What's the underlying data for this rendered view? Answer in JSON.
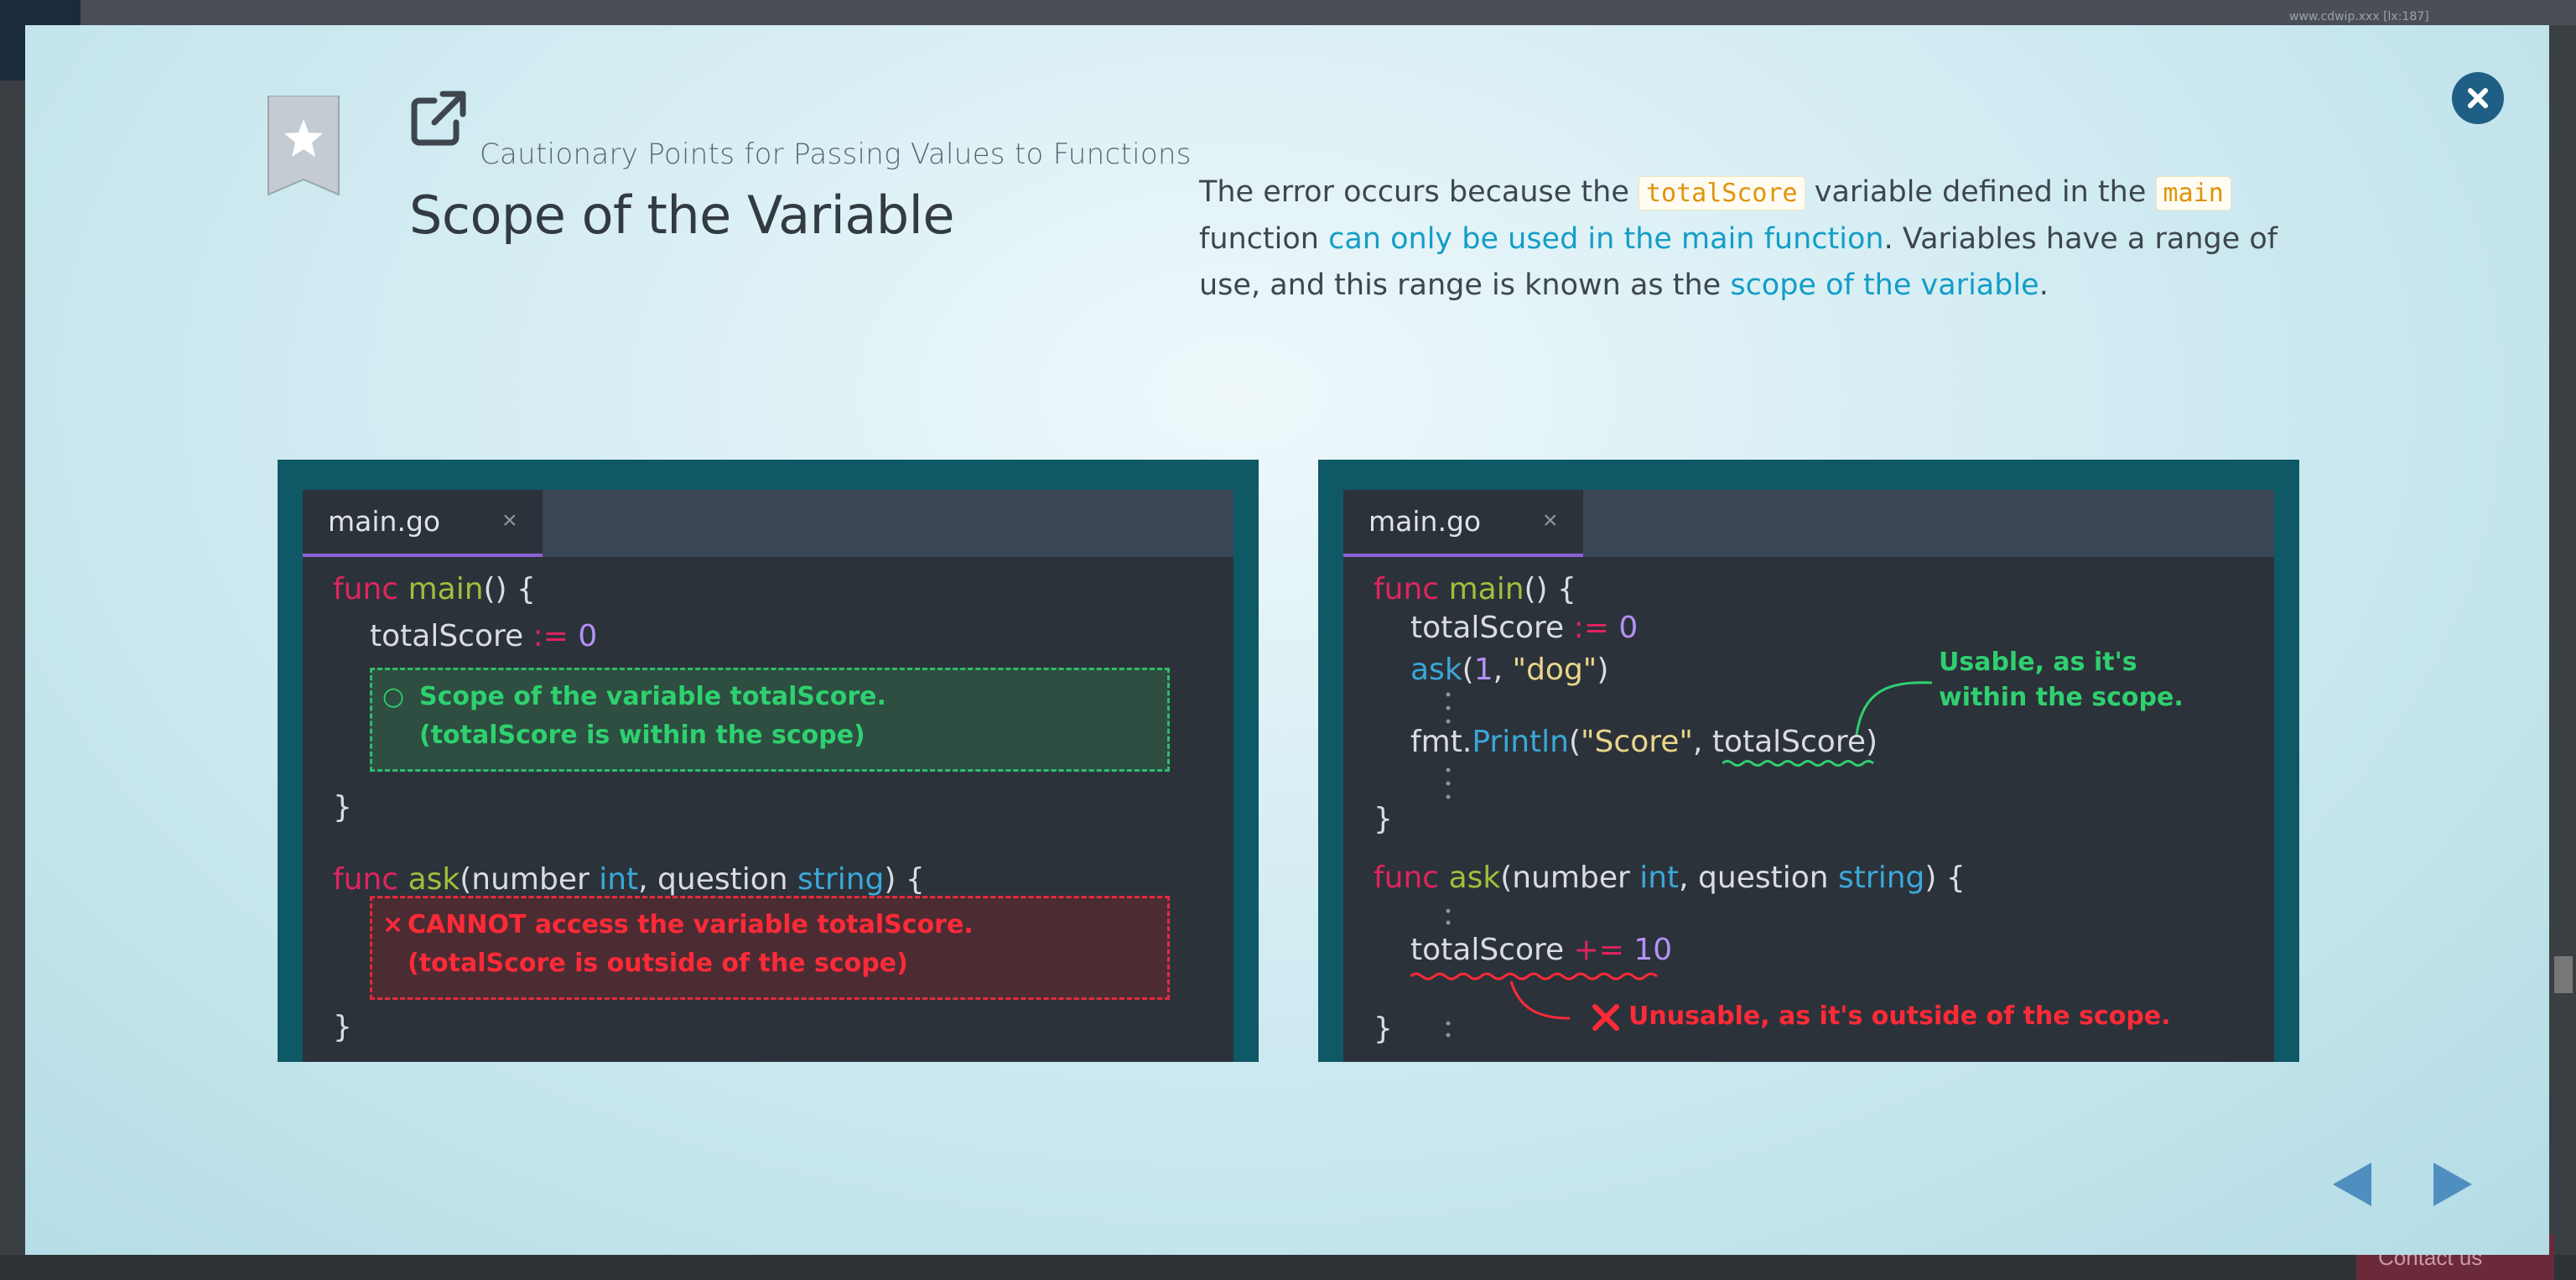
{
  "background": {
    "url_fragment": "www.cdwip.xxx [lx:187]",
    "contact_label": "Contact us"
  },
  "modal": {
    "subtitle": "Cautionary Points for Passing Values to Functions",
    "title": "Scope of the Variable",
    "description": {
      "p1": "The error occurs because the ",
      "code1": "totalScore",
      "p2": " variable defined in the ",
      "code2": "main",
      "p3": " function ",
      "hl1": "can only be used in the main function",
      "p4": ". Variables have a range of use, and this range is known as the ",
      "hl2": "scope of the variable",
      "p5": "."
    },
    "icons": {
      "bookmark": "bookmark-star-icon",
      "external": "external-link-icon",
      "close": "close-icon",
      "prev": "arrow-left-icon",
      "next": "arrow-right-icon"
    },
    "colors": {
      "accent": "#1f5f85",
      "highlight": "#139dc7",
      "code_tag": "#e0930b",
      "panel_frame": "#0f5866",
      "editor_bg": "#2c323a",
      "ok_green": "#2fd06f",
      "error_red": "#ff2a38"
    }
  },
  "left_panel": {
    "tab": "main.go",
    "tab_close": "×",
    "line1_kw": "func",
    "line1_fn": "main",
    "line1_rest": "() {",
    "line2_var": "totalScore",
    "line2_op": ":=",
    "line2_num": "0",
    "ok_mark": "○",
    "ok_line1": "Scope of the variable totalScore.",
    "ok_line2": "(totalScore is within the scope)",
    "brace1": "}",
    "line5_kw": "func",
    "line5_fn": "ask",
    "line5_a": "(number ",
    "line5_t1": "int",
    "line5_b": ", question ",
    "line5_t2": "string",
    "line5_c": ") {",
    "bad_mark": "×",
    "bad_line1": "CANNOT access the variable totalScore.",
    "bad_line2": "(totalScore is outside of the scope)",
    "brace2": "}"
  },
  "right_panel": {
    "tab": "main.go",
    "tab_close": "×",
    "line1_kw": "func",
    "line1_fn": "main",
    "line1_rest": "() {",
    "line2_var": "totalScore",
    "line2_op": ":=",
    "line2_num": "0",
    "line3_call": "ask",
    "line3_a": "(",
    "line3_n": "1",
    "line3_b": ", ",
    "line3_s": "\"dog\"",
    "line3_c": ")",
    "line4_pkg": "fmt.",
    "line4_call": "Println",
    "line4_a": "(",
    "line4_s": "\"Score\"",
    "line4_b": ", ",
    "line4_var": "totalScore",
    "line4_c": ")",
    "usable_1": "Usable, as it's",
    "usable_2": "within the scope.",
    "brace1": "}",
    "line6_kw": "func",
    "line6_fn": "ask",
    "line6_a": "(number ",
    "line6_t1": "int",
    "line6_b": ", question ",
    "line6_t2": "string",
    "line6_c": ") {",
    "line7_var": "totalScore",
    "line7_op": "+=",
    "line7_num": "10",
    "unusable": "Unusable, as it's outside of the scope.",
    "brace2": "}"
  }
}
